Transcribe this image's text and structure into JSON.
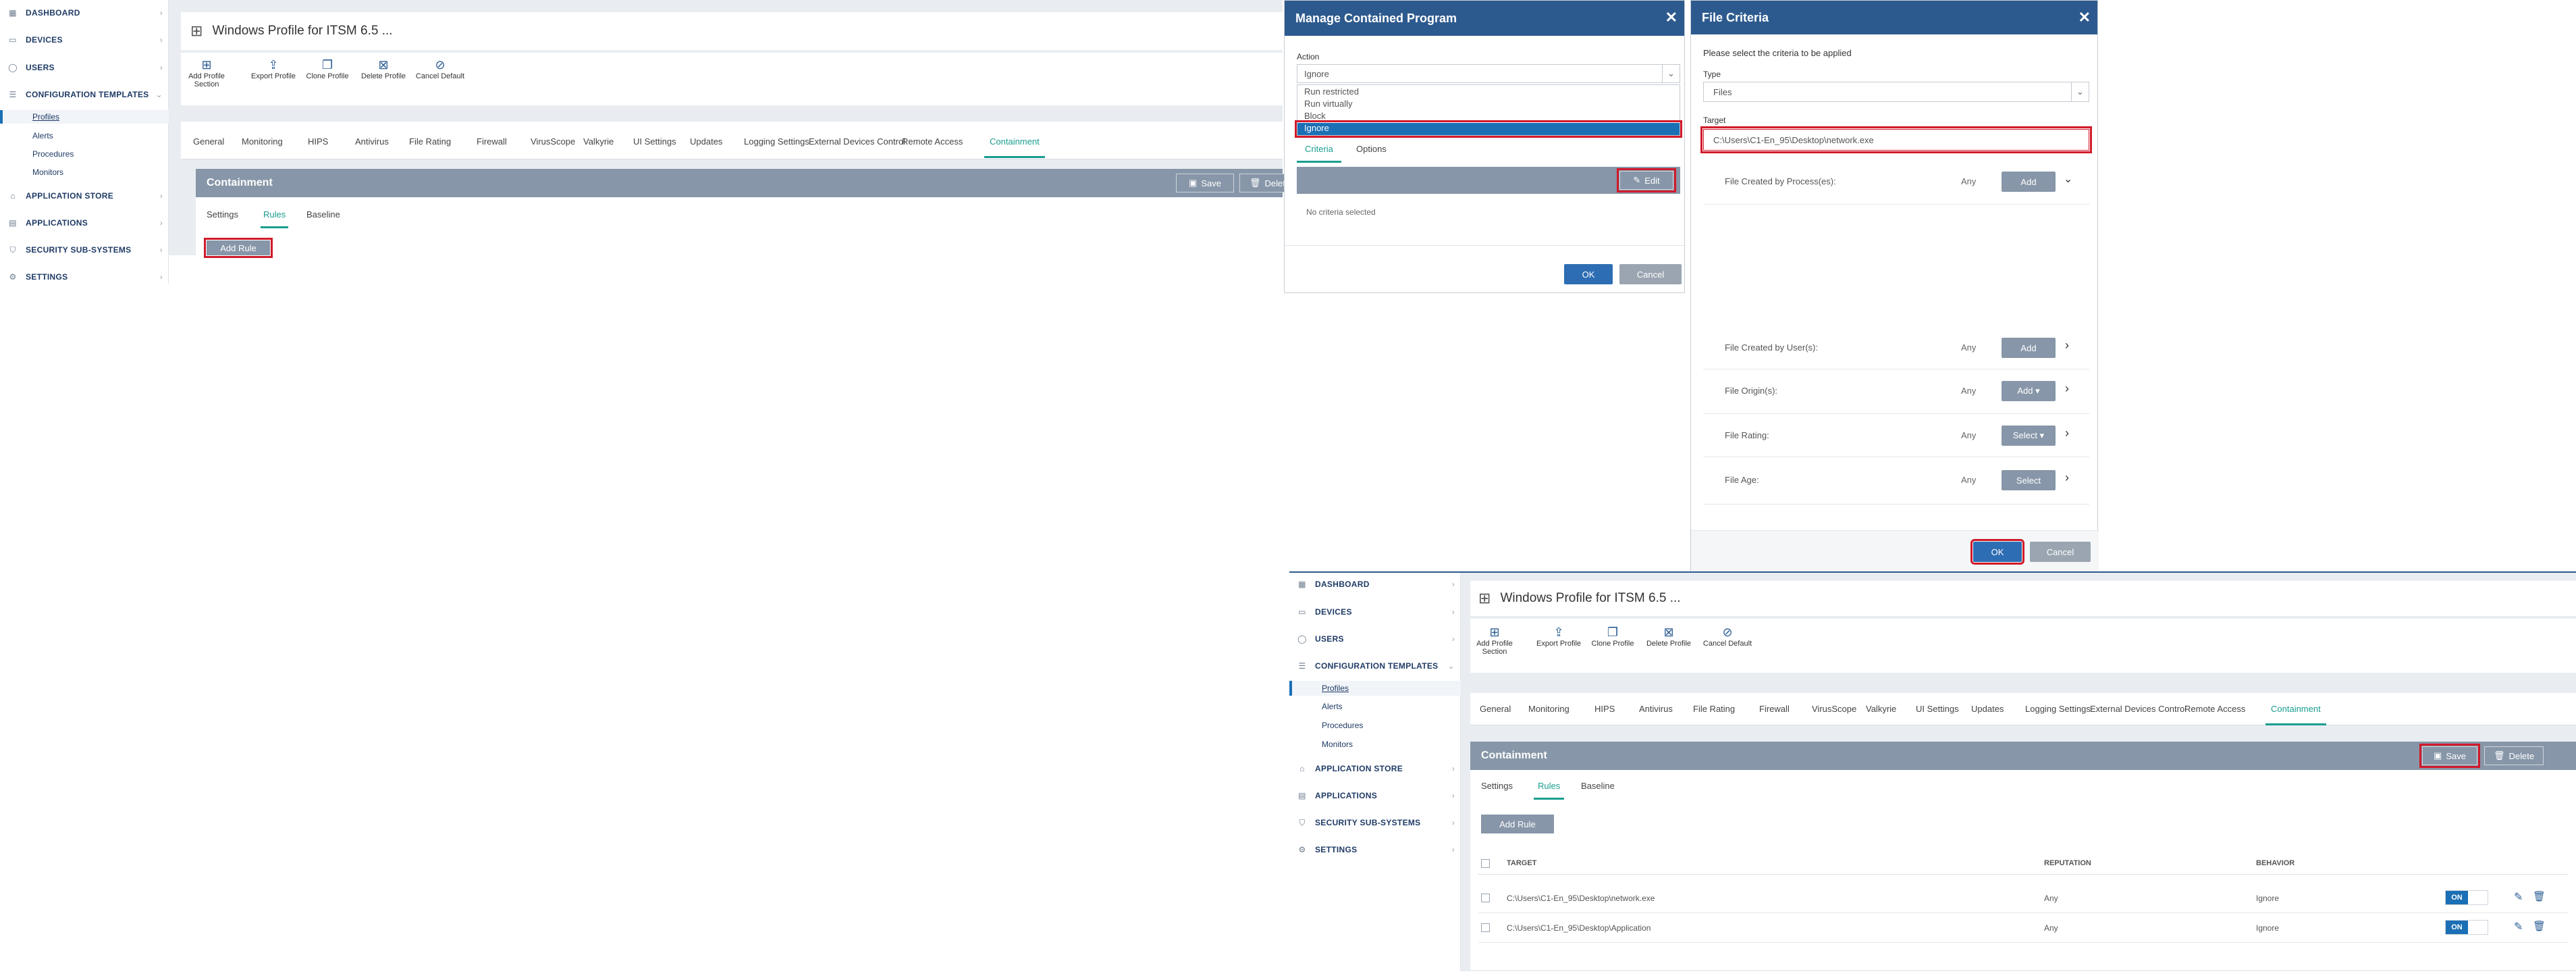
{
  "nav": {
    "items": [
      {
        "label": "DASHBOARD",
        "icon": "dashboard-icon"
      },
      {
        "label": "DEVICES",
        "icon": "devices-icon"
      },
      {
        "label": "USERS",
        "icon": "users-icon"
      },
      {
        "label": "CONFIGURATION TEMPLATES",
        "icon": "templates-icon"
      },
      {
        "label": "APPLICATION STORE",
        "icon": "store-icon"
      },
      {
        "label": "APPLICATIONS",
        "icon": "applications-icon"
      },
      {
        "label": "SECURITY SUB-SYSTEMS",
        "icon": "shield-icon"
      },
      {
        "label": "SETTINGS",
        "icon": "gear-icon"
      }
    ],
    "subitems": [
      "Profiles",
      "Alerts",
      "Procedures",
      "Monitors"
    ],
    "active_sub": "Profiles"
  },
  "profile": {
    "title": "Windows Profile for ITSM 6.5 ...",
    "toolbar": [
      {
        "label": "Add Profile Section",
        "icon": "add-section-icon"
      },
      {
        "label": "Export Profile",
        "icon": "export-icon"
      },
      {
        "label": "Clone Profile",
        "icon": "clone-icon"
      },
      {
        "label": "Delete Profile",
        "icon": "delete-profile-icon"
      },
      {
        "label": "Cancel Default",
        "icon": "cancel-default-icon"
      }
    ],
    "tabs": [
      "General",
      "Monitoring",
      "HIPS",
      "Antivirus",
      "File Rating",
      "Firewall",
      "VirusScope",
      "Valkyrie",
      "UI Settings",
      "Updates",
      "Logging Settings",
      "External Devices Control",
      "Remote Access",
      "Containment"
    ],
    "active_tab": "Containment",
    "section_title": "Containment",
    "save_label": "Save",
    "delete_label": "Delete",
    "subtabs": [
      "Settings",
      "Rules",
      "Baseline"
    ],
    "active_subtab": "Rules",
    "add_rule_label": "Add Rule"
  },
  "manage_dialog": {
    "title": "Manage Contained Program",
    "action_label": "Action",
    "action_value": "Ignore",
    "options": [
      "Run restricted",
      "Run virtually",
      "Block",
      "Ignore"
    ],
    "selected_option": "Ignore",
    "tabs": [
      "Criteria",
      "Options"
    ],
    "edit_label": "Edit",
    "empty_text": "No criteria selected",
    "ok_label": "OK",
    "cancel_label": "Cancel"
  },
  "file_criteria": {
    "title": "File Criteria",
    "intro": "Please select the criteria to be applied",
    "type_label": "Type",
    "type_value": "Files",
    "target_label": "Target",
    "target_value": "C:\\Users\\C1-En_95\\Desktop\\network.exe",
    "rows": [
      {
        "label": "File Created by Process(es):",
        "value": "Any",
        "button": "Add",
        "chev": "⌄"
      },
      {
        "label": "File Created by User(s):",
        "value": "Any",
        "button": "Add",
        "chev": "›"
      },
      {
        "label": "File Origin(s):",
        "value": "Any",
        "button": "Add ▾",
        "chev": "›"
      },
      {
        "label": "File Rating:",
        "value": "Any",
        "button": "Select ▾",
        "chev": "›"
      },
      {
        "label": "File Age:",
        "value": "Any",
        "button": "Select",
        "chev": "›"
      }
    ],
    "ok_label": "OK",
    "cancel_label": "Cancel"
  },
  "rules_table": {
    "headers": [
      "TARGET",
      "REPUTATION",
      "BEHAVIOR"
    ],
    "rows": [
      {
        "target": "C:\\Users\\C1-En_95\\Desktop\\network.exe",
        "reputation": "Any",
        "behavior": "Ignore",
        "toggle": "ON"
      },
      {
        "target": "C:\\Users\\C1-En_95\\Desktop\\Application",
        "reputation": "Any",
        "behavior": "Ignore",
        "toggle": "ON"
      }
    ]
  },
  "colors": {
    "accent": "#1a9e8f",
    "header_blue": "#2d5a8e",
    "nav_text": "#1f3b66",
    "highlight_red": "#d11a2a",
    "bar_grey": "#8796a8"
  }
}
